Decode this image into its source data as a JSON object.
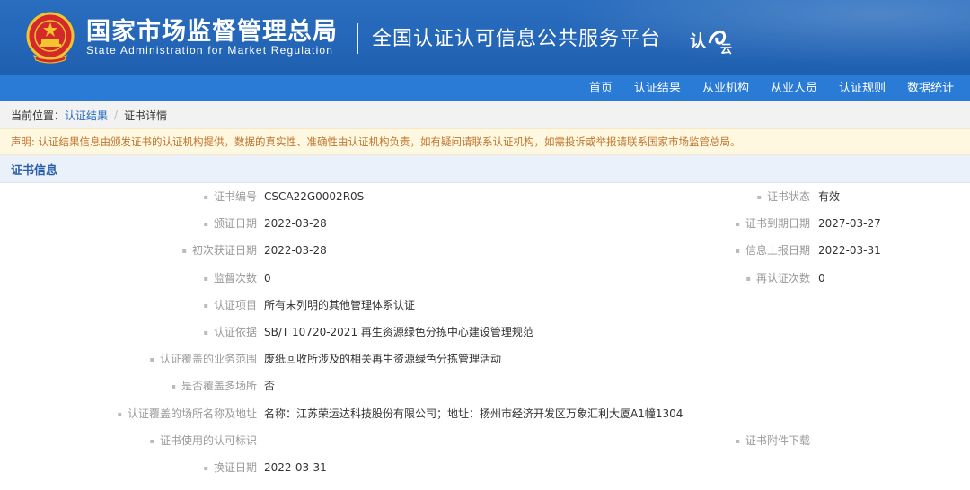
{
  "header": {
    "title_cn": "国家市场监督管理总局",
    "title_en": "State Administration  for  Market Regulation",
    "platform": "全国认证认可信息公共服务平台",
    "logo_text": "认云"
  },
  "nav": [
    "首页",
    "认证结果",
    "从业机构",
    "从业人员",
    "认证规则",
    "数据统计"
  ],
  "breadcrumb": {
    "label": "当前位置：",
    "items": [
      "认证结果",
      "证书详情"
    ],
    "separator": "/"
  },
  "notice": "声明: 认证结果信息由颁发证书的认证机构提供，数据的真实性、准确性由认证机构负责，如有疑问请联系认证机构，如需投诉或举报请联系国家市场监管总局。",
  "section_title": "证书信息",
  "fields": {
    "cert_no": {
      "label": "证书编号",
      "value": "CSCA22G0002R0S"
    },
    "status": {
      "label": "证书状态",
      "value": "有效"
    },
    "issue_date": {
      "label": "颁证日期",
      "value": "2022-03-28"
    },
    "expire_date": {
      "label": "证书到期日期",
      "value": "2027-03-27"
    },
    "first_date": {
      "label": "初次获证日期",
      "value": "2022-03-28"
    },
    "report_date": {
      "label": "信息上报日期",
      "value": "2022-03-31"
    },
    "supervise_count": {
      "label": "监督次数",
      "value": "0"
    },
    "recert_count": {
      "label": "再认证次数",
      "value": "0"
    },
    "item": {
      "label": "认证项目",
      "value": "所有未列明的其他管理体系认证"
    },
    "basis": {
      "label": "认证依据",
      "value": "SB/T 10720-2021 再生资源绿色分拣中心建设管理规范"
    },
    "scope": {
      "label": "认证覆盖的业务范围",
      "value": "废纸回收所涉及的相关再生资源绿色分拣管理活动"
    },
    "multi_site": {
      "label": "是否覆盖多场所",
      "value": "否"
    },
    "site_address": {
      "label": "认证覆盖的场所名称及地址",
      "value": "名称：江苏荣运达科技股份有限公司；地址：扬州市经济开发区万象汇利大厦A1幢1304"
    },
    "mark": {
      "label": "证书使用的认可标识",
      "value": ""
    },
    "attachment": {
      "label": "证书附件下载",
      "value": ""
    },
    "renew_date": {
      "label": "换证日期",
      "value": "2022-03-31"
    }
  }
}
